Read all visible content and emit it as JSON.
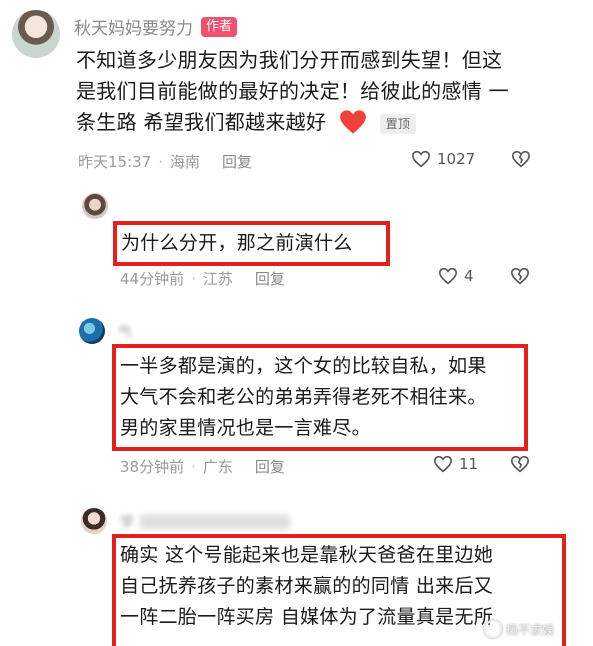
{
  "comments": [
    {
      "author": "秋天妈妈要努力",
      "author_badge": "作者",
      "lines": [
        "不知道多少朋友因为我们分开而感到失望！但这",
        "是我们目前能做的最好的决定！给彼此的感情 一",
        "条生路 希望我们都越来越好"
      ],
      "pinned_label": "置顶",
      "time": "昨天15:37",
      "location": "海南",
      "reply": "回复",
      "likes": "1027"
    },
    {
      "lines": [
        "为什么分开，那之前演什么"
      ],
      "time": "44分钟前",
      "location": "江苏",
      "reply": "回复",
      "likes": "4"
    },
    {
      "author": "气",
      "lines": [
        "一半多都是演的，这个女的比较自私，如果",
        "大气不会和老公的弟弟弄得老死不相往来。",
        "男的家里情况也是一言难尽。"
      ],
      "time": "38分钟前",
      "location": "广东",
      "reply": "回复",
      "likes": "11"
    },
    {
      "author": "学",
      "lines": [
        "确实 这个号能起来也是靠秋天爸爸在里边她",
        "自己抚养孩子的素材来赢的的同情 出来后又",
        "一阵二胎一阵买房 自媒体为了流量真是无所"
      ]
    }
  ],
  "watermark": "杨不求娱",
  "colors": {
    "highlight_box": "#e5201c",
    "author_badge": "#f0506e",
    "meta": "#9a9a9a"
  }
}
